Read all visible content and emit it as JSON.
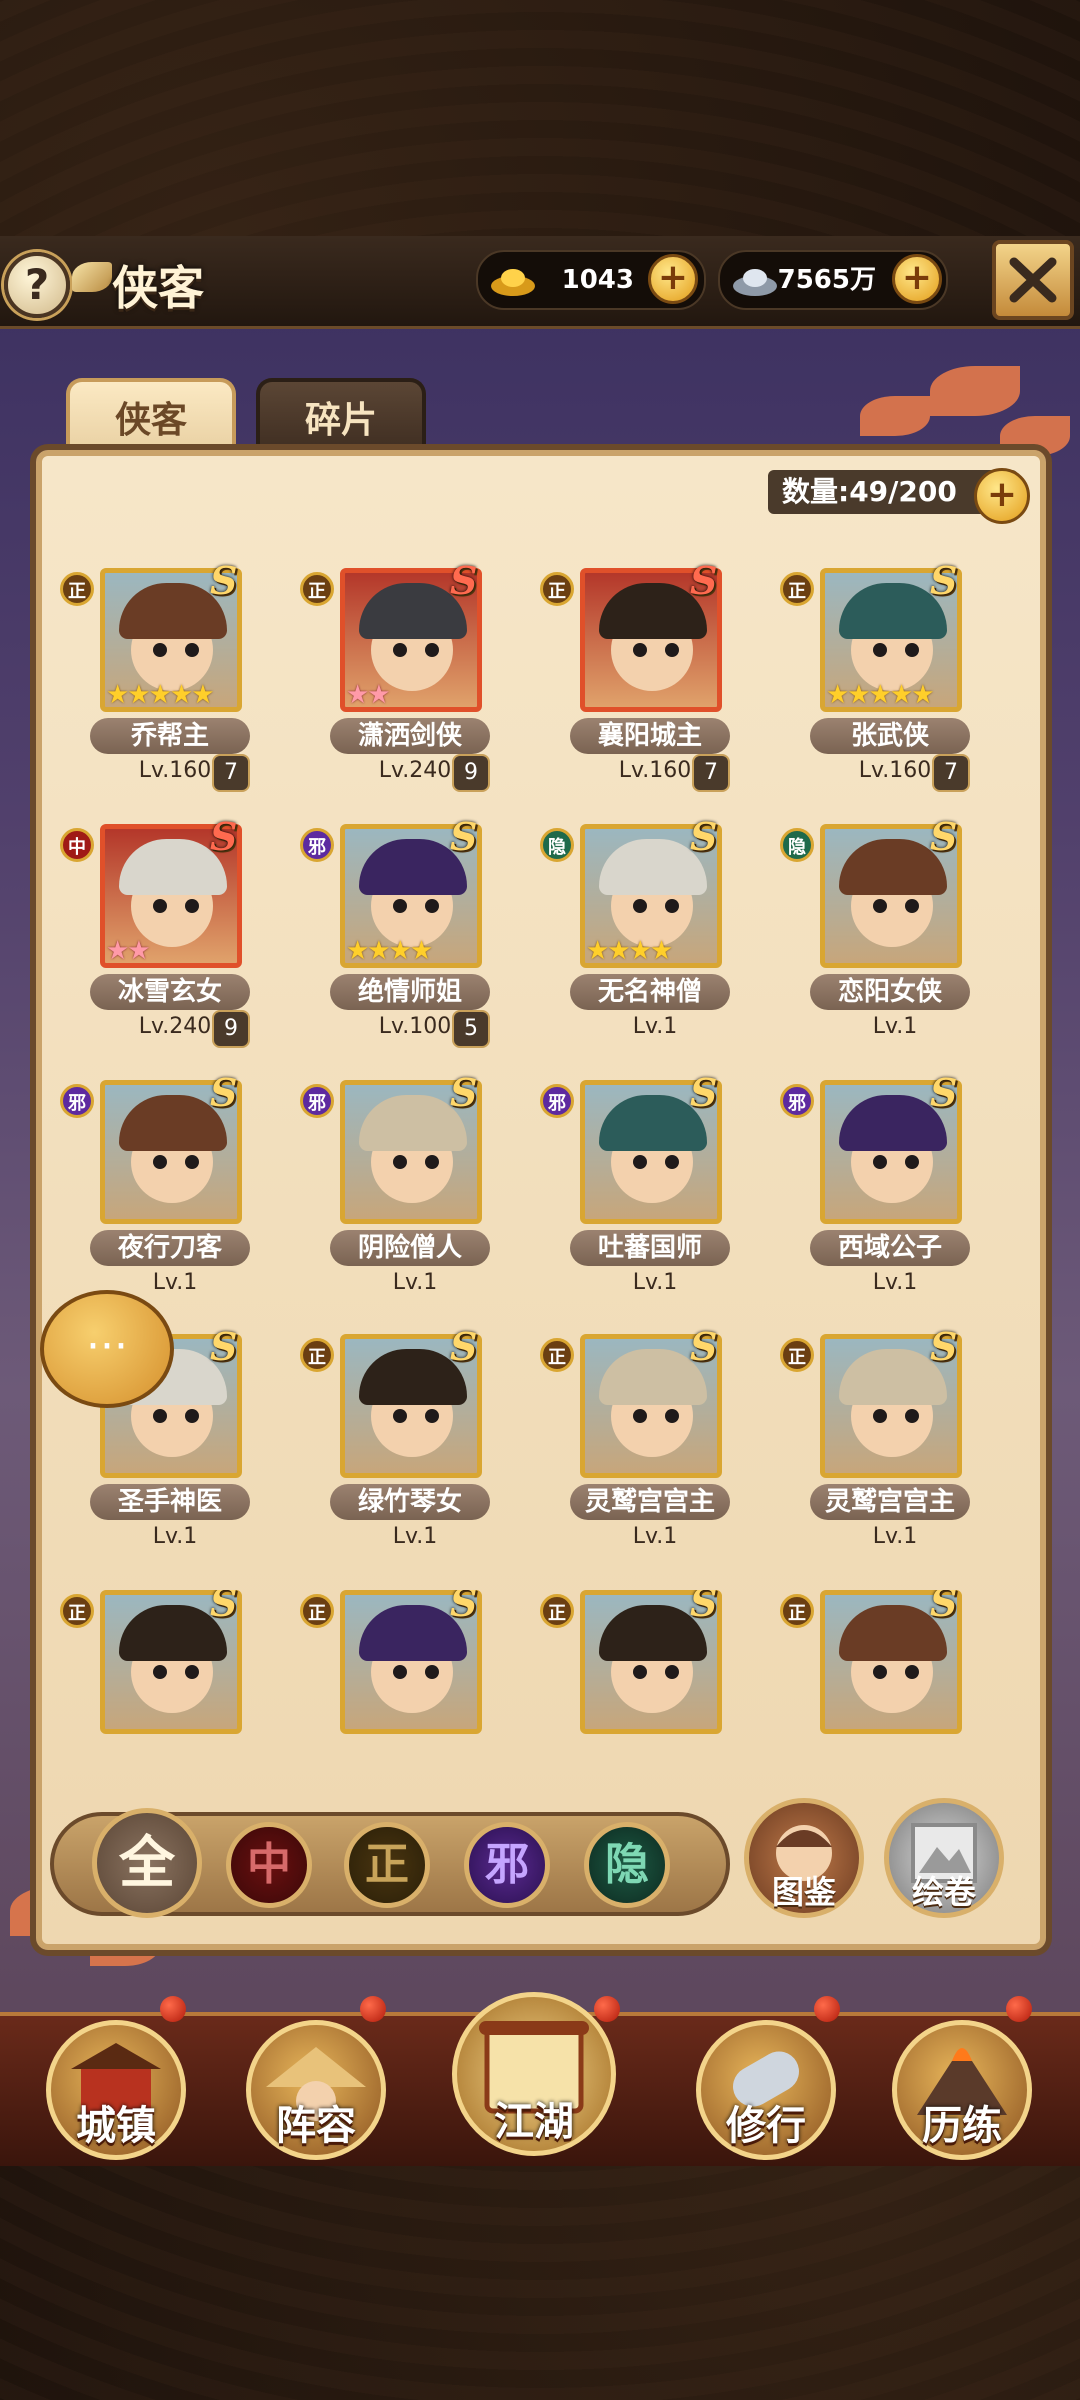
{
  "header": {
    "title": "侠客",
    "help_label": "?",
    "currency": [
      {
        "icon": "gold-ingot-icon",
        "value": "1043"
      },
      {
        "icon": "silver-ingot-icon",
        "value": "7565万"
      }
    ],
    "plus_label": "+"
  },
  "tabs": [
    {
      "label": "侠客",
      "active": true
    },
    {
      "label": "碎片",
      "active": false
    }
  ],
  "count_label": "数量:49/200",
  "heroes": [
    {
      "name": "乔帮主",
      "level": "Lv.160",
      "badge": "7",
      "faction": "正",
      "grade": "S",
      "stars": "★★★★★"
    },
    {
      "name": "潇洒剑侠",
      "level": "Lv.240",
      "badge": "9",
      "faction": "正",
      "grade": "S",
      "stars": "★★"
    },
    {
      "name": "襄阳城主",
      "level": "Lv.160",
      "badge": "7",
      "faction": "正",
      "grade": "S",
      "stars": ""
    },
    {
      "name": "张武侠",
      "level": "Lv.160",
      "badge": "7",
      "faction": "正",
      "grade": "S",
      "stars": "★★★★★"
    },
    {
      "name": "冰雪玄女",
      "level": "Lv.240",
      "badge": "9",
      "faction": "中",
      "grade": "S",
      "stars": "★★"
    },
    {
      "name": "绝情师姐",
      "level": "Lv.100",
      "badge": "5",
      "faction": "邪",
      "grade": "S",
      "stars": "★★★★"
    },
    {
      "name": "无名神僧",
      "level": "Lv.1",
      "badge": "",
      "faction": "隐",
      "grade": "S",
      "stars": "★★★★"
    },
    {
      "name": "恋阳女侠",
      "level": "Lv.1",
      "badge": "",
      "faction": "隐",
      "grade": "S",
      "stars": ""
    },
    {
      "name": "夜行刀客",
      "level": "Lv.1",
      "badge": "",
      "faction": "邪",
      "grade": "S",
      "stars": ""
    },
    {
      "name": "阴险僧人",
      "level": "Lv.1",
      "badge": "",
      "faction": "邪",
      "grade": "S",
      "stars": ""
    },
    {
      "name": "吐蕃国师",
      "level": "Lv.1",
      "badge": "",
      "faction": "邪",
      "grade": "S",
      "stars": ""
    },
    {
      "name": "西域公子",
      "level": "Lv.1",
      "badge": "",
      "faction": "邪",
      "grade": "S",
      "stars": ""
    },
    {
      "name": "圣手神医",
      "level": "Lv.1",
      "badge": "",
      "faction": "",
      "grade": "S",
      "stars": ""
    },
    {
      "name": "绿竹琴女",
      "level": "Lv.1",
      "badge": "",
      "faction": "正",
      "grade": "S",
      "stars": ""
    },
    {
      "name": "灵鹫宫宫主",
      "level": "Lv.1",
      "badge": "",
      "faction": "正",
      "grade": "S",
      "stars": ""
    },
    {
      "name": "灵鹫宫宫主",
      "level": "Lv.1",
      "badge": "",
      "faction": "正",
      "grade": "S",
      "stars": ""
    },
    {
      "name": "",
      "level": "",
      "badge": "",
      "faction": "正",
      "grade": "S",
      "stars": ""
    },
    {
      "name": "",
      "level": "",
      "badge": "",
      "faction": "正",
      "grade": "S",
      "stars": ""
    },
    {
      "name": "",
      "level": "",
      "badge": "",
      "faction": "正",
      "grade": "S",
      "stars": ""
    },
    {
      "name": "",
      "level": "",
      "badge": "",
      "faction": "正",
      "grade": "S",
      "stars": ""
    }
  ],
  "filters": [
    "全",
    "中",
    "正",
    "邪",
    "隐"
  ],
  "side_buttons": [
    {
      "label": "图鉴",
      "icon": "codex-portrait-icon"
    },
    {
      "label": "绘卷",
      "icon": "scroll-painting-icon"
    }
  ],
  "chat_label": "···",
  "nav": [
    {
      "label": "城镇",
      "icon": "town-gate-icon"
    },
    {
      "label": "阵容",
      "icon": "straw-hat-icon"
    },
    {
      "label": "江湖",
      "icon": "scroll-map-icon"
    },
    {
      "label": "修行",
      "icon": "cannon-scroll-icon"
    },
    {
      "label": "历练",
      "icon": "volcano-icon"
    }
  ]
}
